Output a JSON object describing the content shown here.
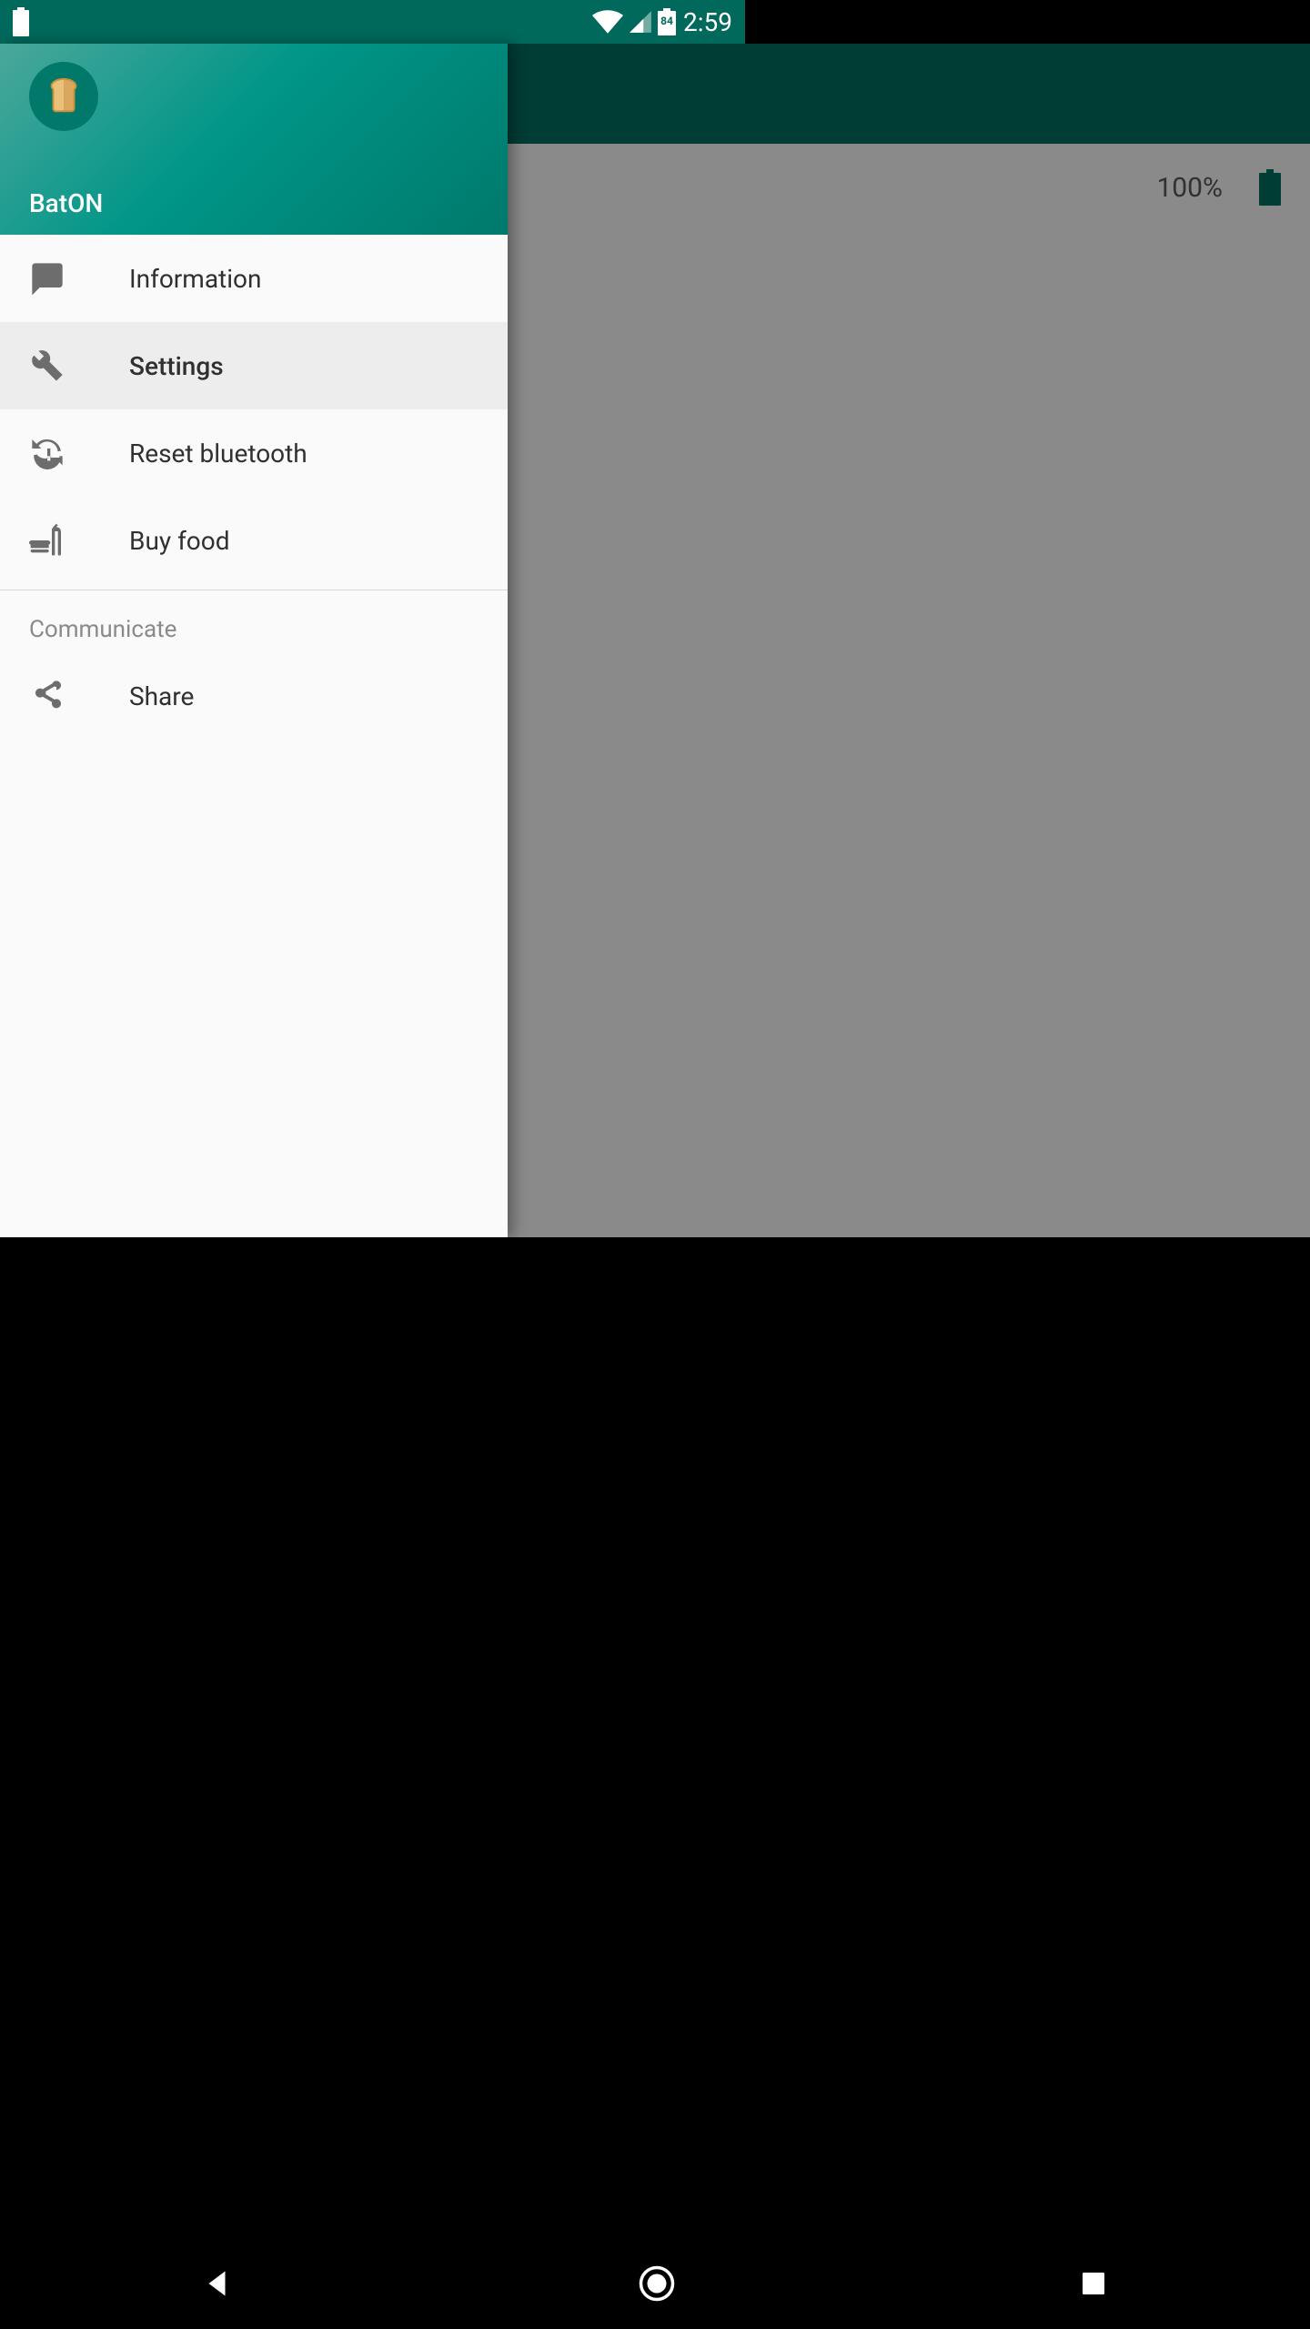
{
  "statusbar": {
    "battery_level": "84",
    "clock": "2:59"
  },
  "app": {
    "device_battery_pct": "100%"
  },
  "drawer": {
    "app_name": "BatON",
    "items": [
      {
        "label": "Information",
        "selected": false,
        "icon": "chat"
      },
      {
        "label": "Settings",
        "selected": true,
        "icon": "wrench"
      },
      {
        "label": "Reset bluetooth",
        "selected": false,
        "icon": "syncwarn"
      },
      {
        "label": "Buy food",
        "selected": false,
        "icon": "food"
      }
    ],
    "section_header": "Communicate",
    "comm_items": [
      {
        "label": "Share",
        "icon": "share"
      }
    ]
  }
}
